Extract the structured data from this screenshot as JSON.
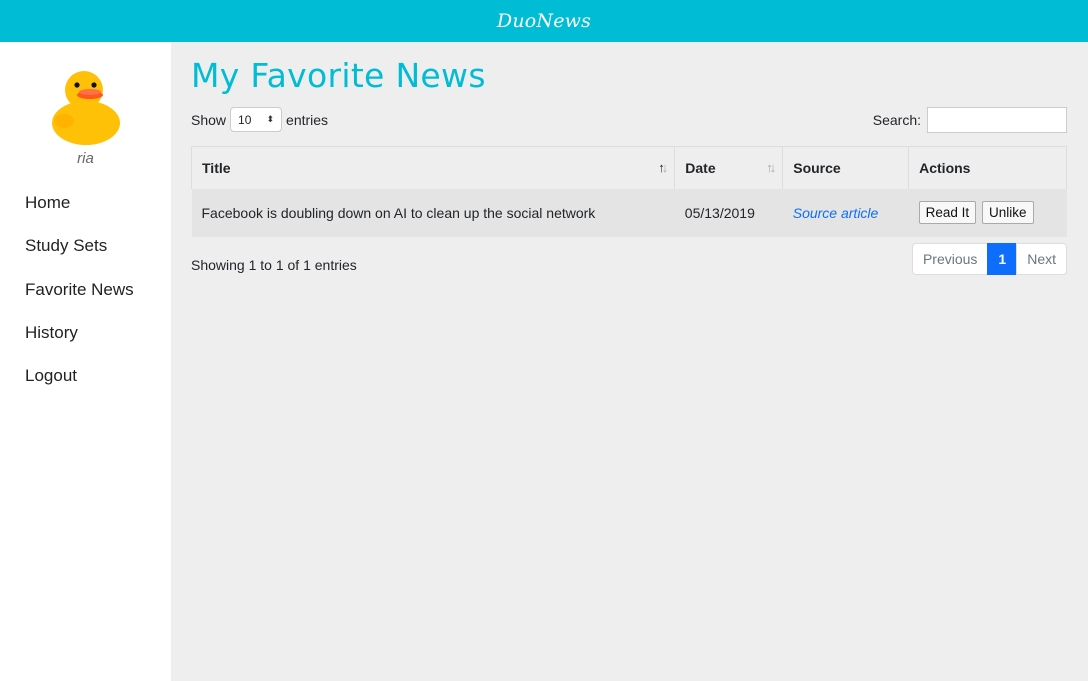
{
  "app": {
    "brand": "DuoNews"
  },
  "sidebar": {
    "username": "ria",
    "nav": [
      {
        "label": "Home"
      },
      {
        "label": "Study Sets"
      },
      {
        "label": "Favorite News"
      },
      {
        "label": "History"
      },
      {
        "label": "Logout"
      }
    ]
  },
  "main": {
    "title": "My Favorite News",
    "length": {
      "prefix": "Show",
      "value": "10",
      "suffix": "entries"
    },
    "search": {
      "label": "Search:",
      "value": ""
    },
    "table": {
      "headers": [
        "Title",
        "Date",
        "Source",
        "Actions"
      ],
      "rows": [
        {
          "title": "Facebook is doubling down on AI to clean up the social network",
          "date": "05/13/2019",
          "source": "Source article",
          "read_label": "Read It",
          "unlike_label": "Unlike"
        }
      ]
    },
    "info": "Showing 1 to 1 of 1 entries",
    "pagination": {
      "previous": "Previous",
      "current": "1",
      "next": "Next"
    }
  },
  "colors": {
    "accent": "#00bcd4",
    "link": "#0d6efd"
  }
}
